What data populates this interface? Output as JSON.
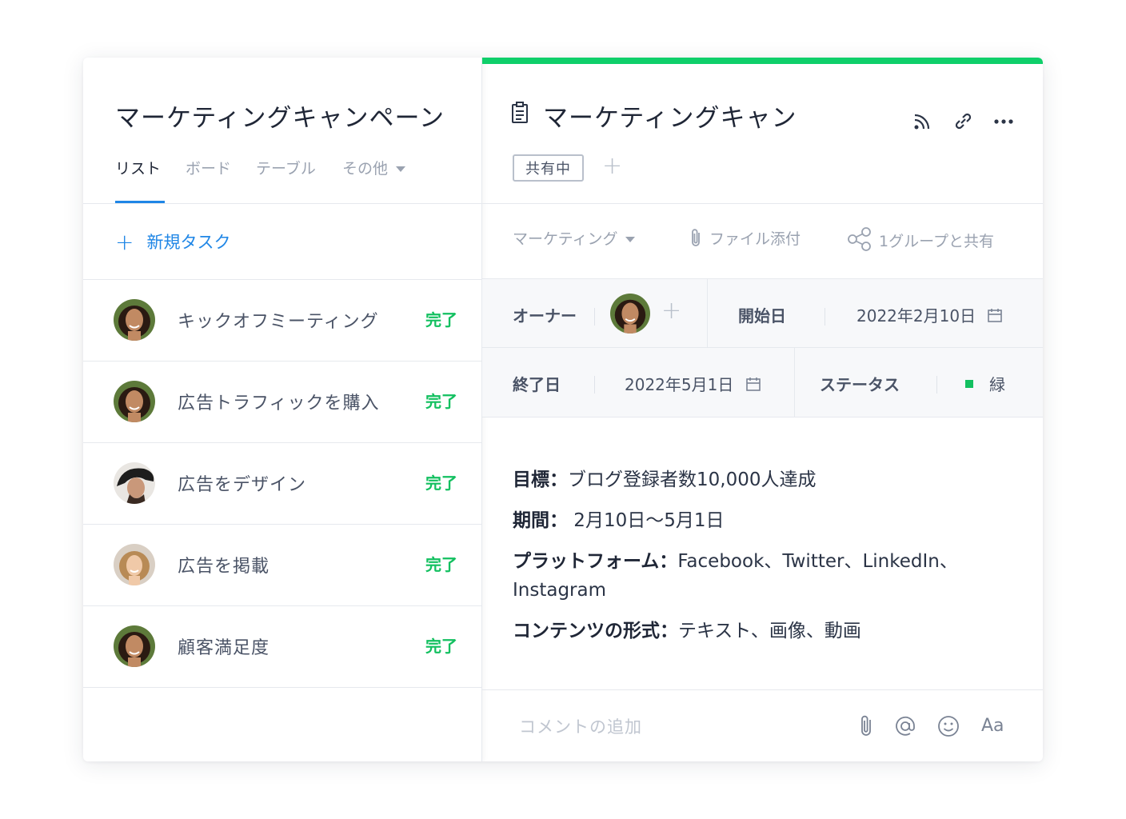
{
  "left": {
    "title": "マーケティングキャンペーン",
    "tabs": [
      {
        "label": "リスト",
        "active": true
      },
      {
        "label": "ボード",
        "active": false
      },
      {
        "label": "テーブル",
        "active": false
      },
      {
        "label": "その他",
        "active": false
      }
    ],
    "new_task": "新規タスク",
    "tasks": [
      {
        "name": "キックオフミーティング",
        "status": "完了"
      },
      {
        "name": "広告トラフィックを購入",
        "status": "完了"
      },
      {
        "name": "広告をデザイン",
        "status": "完了"
      },
      {
        "name": "広告を掲載",
        "status": "完了"
      },
      {
        "name": "顧客満足度",
        "status": "完了"
      }
    ]
  },
  "detail": {
    "title": "マーケティングキャン",
    "badge": "共有中",
    "meta": {
      "folder": "マーケティング",
      "attach": "ファイル添付",
      "share": "1グループと共有"
    },
    "fields": {
      "owner_label": "オーナー",
      "start_label": "開始日",
      "start_value": "2022年2月10日",
      "end_label": "終了日",
      "end_value": "2022年5月1日",
      "status_label": "ステータス",
      "status_value": "緑"
    },
    "description": {
      "goal_label": "目標：",
      "goal_value": "ブログ登録者数10,000人達成",
      "period_label": "期間：",
      "period_value": " 2月10日〜5月1日",
      "platform_label": "プラットフォーム：",
      "platform_value": "Facebook、Twitter、LinkedIn、Instagram",
      "content_label": "コンテンツの形式：",
      "content_value": "テキスト、画像、動画"
    },
    "comment_placeholder": "コメントの追加",
    "text_format": "Aa"
  },
  "colors": {
    "accent_green": "#0fcf6a",
    "status_green": "#13c060",
    "link_blue": "#1f86e6"
  },
  "icons": [
    "document-icon",
    "rss-icon",
    "link-icon",
    "more-icon",
    "paperclip-icon",
    "share-icon",
    "calendar-icon",
    "at-icon",
    "emoji-icon"
  ]
}
